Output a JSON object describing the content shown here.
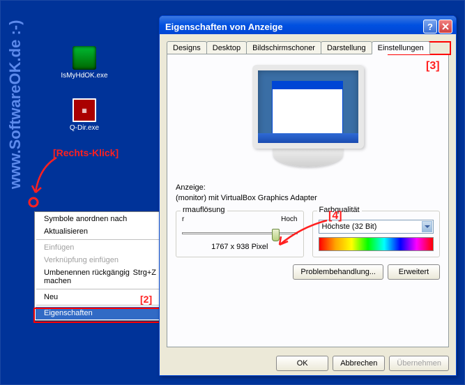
{
  "watermark": "www.SoftwareOK.de :-)",
  "desktop": {
    "icons": [
      {
        "label": "IsMyHdOK.exe"
      },
      {
        "label": "Q-Dir.exe"
      }
    ]
  },
  "annotations": {
    "rightclick": "[Rechts-Klick]",
    "n2": "[2]",
    "n3": "[3]",
    "n4": "[4]"
  },
  "context_menu": {
    "arrange": "Symbole anordnen nach",
    "refresh": "Aktualisieren",
    "paste": "Einfügen",
    "paste_link": "Verknüpfung einfügen",
    "undo_rename": "Umbenennen rückgängig machen",
    "undo_shortcut": "Strg+Z",
    "new": "Neu",
    "properties": "Eigenschaften"
  },
  "dialog": {
    "title": "Eigenschaften von Anzeige",
    "tabs": {
      "designs": "Designs",
      "desktop": "Desktop",
      "screensaver": "Bildschirmschoner",
      "appearance": "Darstellung",
      "settings": "Einstellungen"
    },
    "display_label": "Anzeige:",
    "display_value": "(monitor) mit VirtualBox Graphics Adapter",
    "resolution": {
      "legend": "rmauflösung",
      "less": "r",
      "more": "Hoch",
      "current": "1767 x 938 Pixel"
    },
    "quality": {
      "legend": "Farbqualität",
      "value": "Höchste (32 Bit)"
    },
    "troubleshoot": "Problembehandlung...",
    "advanced": "Erweitert",
    "ok": "OK",
    "cancel": "Abbrechen",
    "apply": "Übernehmen"
  }
}
